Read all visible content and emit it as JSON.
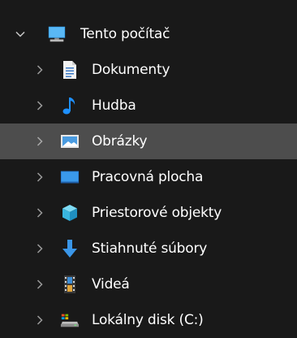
{
  "tree": {
    "root": {
      "label": "Tento počítač",
      "icon": "computer-icon",
      "expanded": true
    },
    "items": [
      {
        "label": "Dokumenty",
        "icon": "document-icon"
      },
      {
        "label": "Hudba",
        "icon": "music-note-icon"
      },
      {
        "label": "Obrázky",
        "icon": "picture-icon",
        "selected": true
      },
      {
        "label": "Pracovná plocha",
        "icon": "desktop-icon"
      },
      {
        "label": "Priestorové objekty",
        "icon": "3d-objects-icon"
      },
      {
        "label": "Stiahnuté súbory",
        "icon": "download-arrow-icon"
      },
      {
        "label": "Videá",
        "icon": "video-film-icon"
      },
      {
        "label": "Lokálny disk (C:)",
        "icon": "local-disk-icon"
      }
    ]
  },
  "colors": {
    "background": "#191919",
    "selected_background": "#4d4d4d",
    "text": "#ffffff",
    "chevron": "#9a9a9a",
    "accent_blue": "#2f8fe6"
  }
}
